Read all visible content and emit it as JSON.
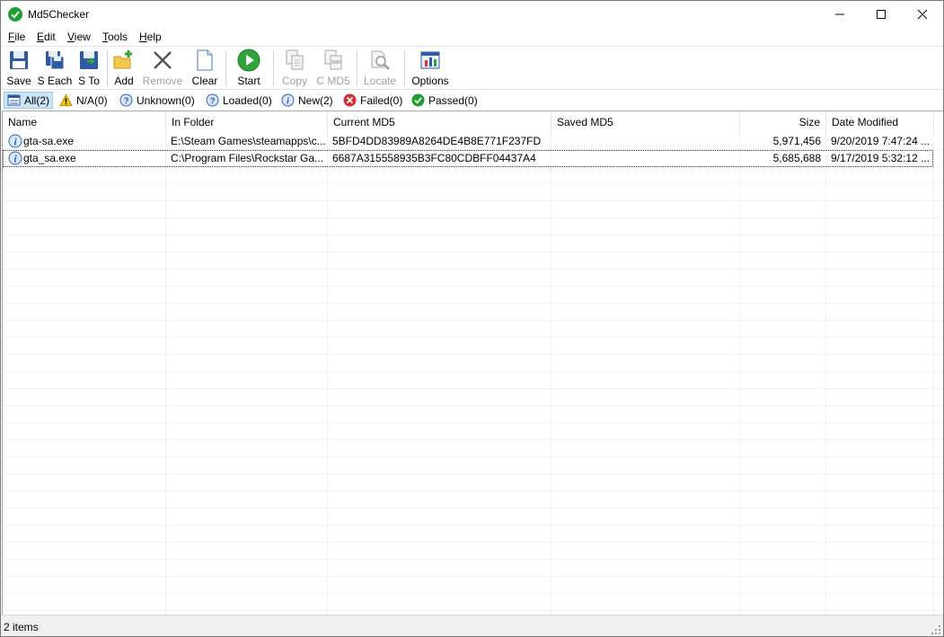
{
  "window": {
    "title": "Md5Checker"
  },
  "menu": [
    {
      "label": "File",
      "accel": "F",
      "rest": "ile"
    },
    {
      "label": "Edit",
      "accel": "E",
      "rest": "dit"
    },
    {
      "label": "View",
      "accel": "V",
      "rest": "iew"
    },
    {
      "label": "Tools",
      "accel": "T",
      "rest": "ools"
    },
    {
      "label": "Help",
      "accel": "H",
      "rest": "elp"
    }
  ],
  "toolbar": {
    "save": "Save",
    "save_each": "S Each",
    "save_to": "S To",
    "add": "Add",
    "remove": "Remove",
    "clear": "Clear",
    "start": "Start",
    "copy": "Copy",
    "copy_md5": "C MD5",
    "locate": "Locate",
    "options": "Options"
  },
  "filters": {
    "all": "All(2)",
    "na": "N/A(0)",
    "unknown": "Unknown(0)",
    "loaded": "Loaded(0)",
    "new": "New(2)",
    "failed": "Failed(0)",
    "passed": "Passed(0)"
  },
  "columns": {
    "name": "Name",
    "folder": "In Folder",
    "current_md5": "Current MD5",
    "saved_md5": "Saved MD5",
    "size": "Size",
    "date_modified": "Date Modified"
  },
  "rows": [
    {
      "name": "gta-sa.exe",
      "folder": "E:\\Steam Games\\steamapps\\c...",
      "current_md5": "5BFD4DD83989A8264DE4B8E771F237FD",
      "saved_md5": "",
      "size": "5,971,456",
      "date_modified": "9/20/2019 7:47:24 ..."
    },
    {
      "name": "gta_sa.exe",
      "folder": "C:\\Program Files\\Rockstar Ga...",
      "current_md5": "6687A315558935B3FC80CDBFF04437A4",
      "saved_md5": "",
      "size": "5,685,688",
      "date_modified": "9/17/2019 5:32:12 ..."
    }
  ],
  "status": {
    "text": "2 items"
  },
  "colors": {
    "accent_green": "#1e9e2f",
    "selection": "#cce4f7",
    "error_red": "#d32f2f",
    "warning_yellow": "#f5c211",
    "info_blue": "#2a64c5"
  }
}
